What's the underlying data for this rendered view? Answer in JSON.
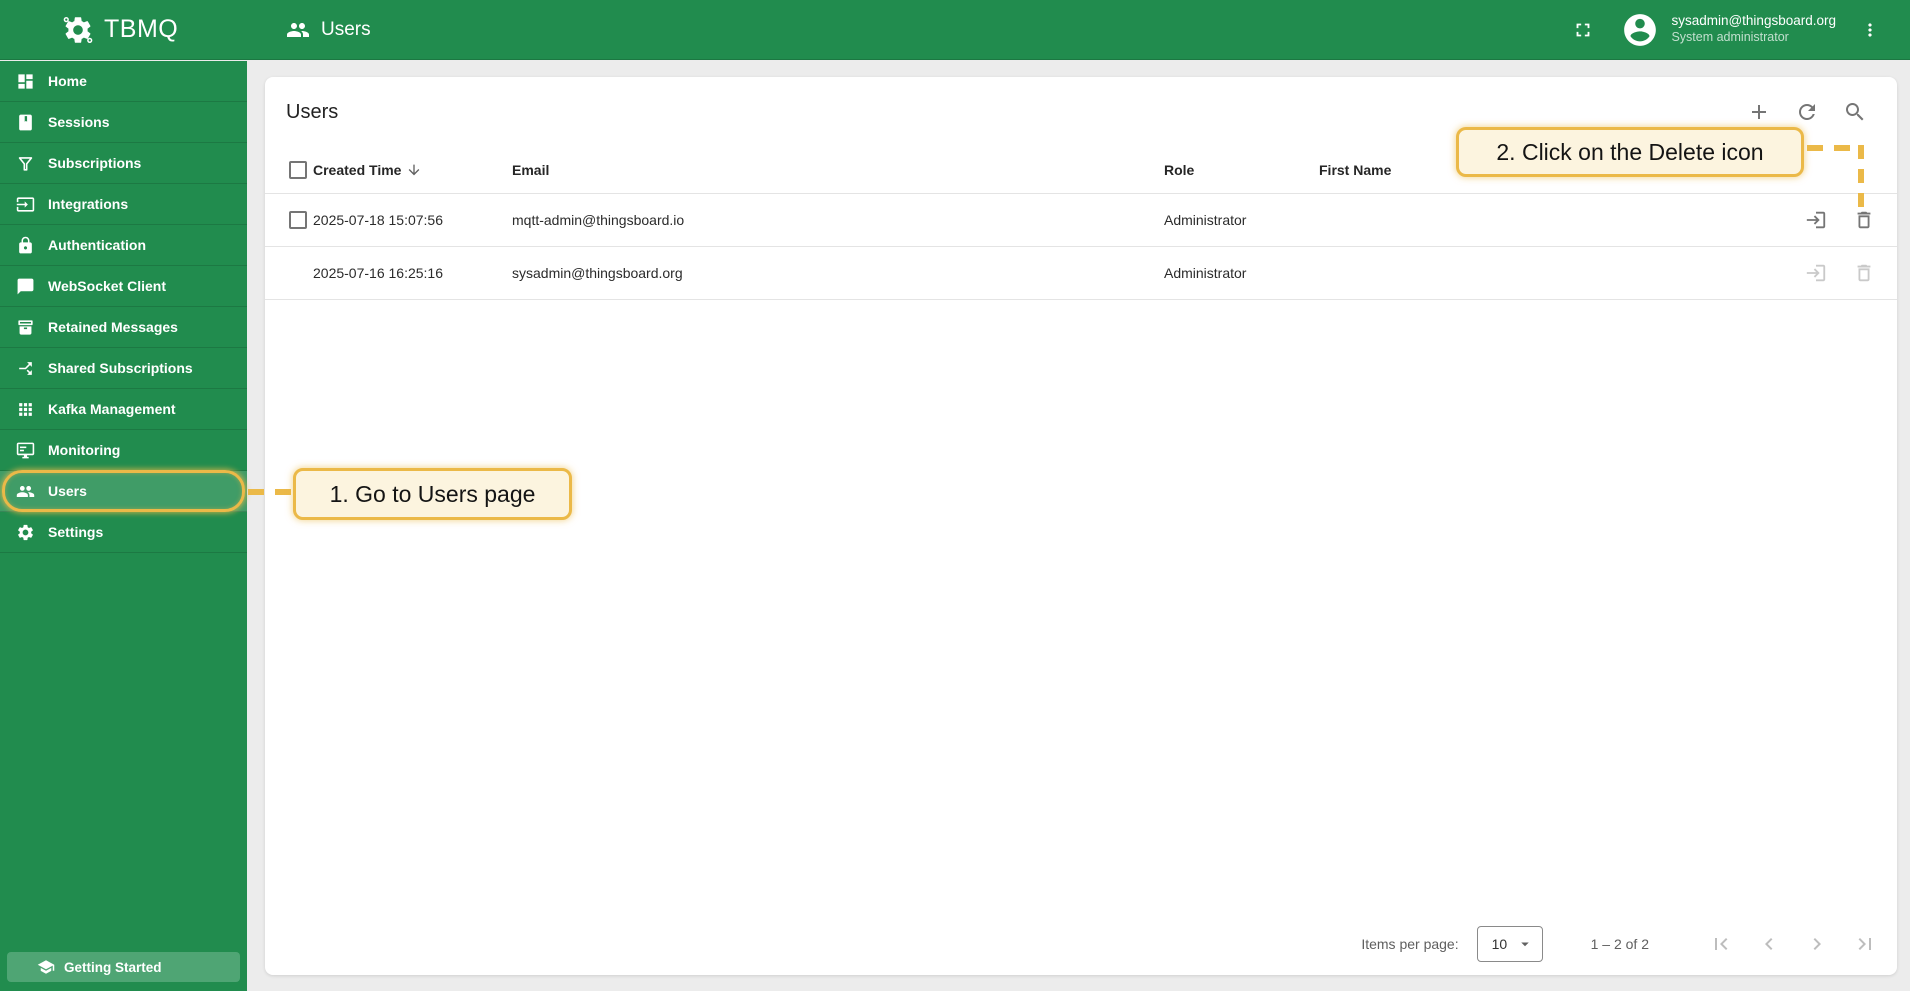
{
  "app": {
    "name": "TBMQ"
  },
  "header": {
    "breadcrumb": "Users",
    "user": {
      "email": "sysadmin@thingsboard.org",
      "role": "System administrator"
    }
  },
  "sidebar": {
    "items": [
      {
        "label": "Home"
      },
      {
        "label": "Sessions"
      },
      {
        "label": "Subscriptions"
      },
      {
        "label": "Integrations"
      },
      {
        "label": "Authentication"
      },
      {
        "label": "WebSocket Client"
      },
      {
        "label": "Retained Messages"
      },
      {
        "label": "Shared Subscriptions"
      },
      {
        "label": "Kafka Management"
      },
      {
        "label": "Monitoring"
      },
      {
        "label": "Users"
      },
      {
        "label": "Settings"
      }
    ],
    "getting_started": "Getting Started"
  },
  "main": {
    "title": "Users",
    "table": {
      "headers": {
        "created": "Created Time",
        "email": "Email",
        "role": "Role",
        "first_name": "First Name"
      },
      "rows": [
        {
          "created": "2025-07-18 15:07:56",
          "email": "mqtt-admin@thingsboard.io",
          "role": "Administrator",
          "first_name": ""
        },
        {
          "created": "2025-07-16 16:25:16",
          "email": "sysadmin@thingsboard.org",
          "role": "Administrator",
          "first_name": ""
        }
      ]
    },
    "pagination": {
      "items_per_page_label": "Items per page:",
      "page_size": "10",
      "range": "1 – 2 of 2"
    }
  },
  "annotations": {
    "step1": "1. Go to Users page",
    "step2": "2. Click on the Delete icon",
    "accent_color": "#EBB948",
    "background_color": "#FCF4DF"
  },
  "colors": {
    "brand_green": "#218C4E",
    "content_background": "#ECECEC"
  }
}
